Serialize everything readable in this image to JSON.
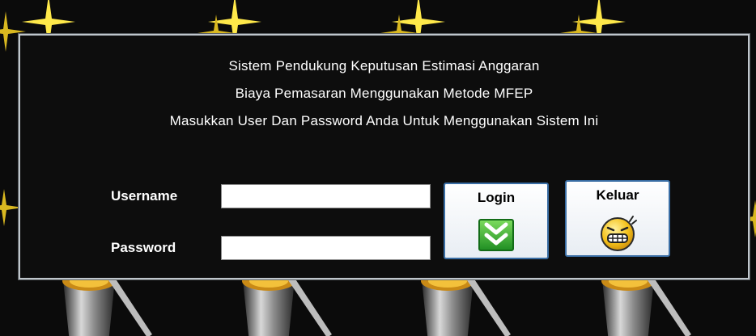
{
  "dialog": {
    "title_line1": "Sistem Pendukung Keputusan Estimasi Anggaran",
    "title_line2": "Biaya Pemasaran Menggunakan Metode MFEP",
    "instruction": "Masukkan User Dan Password Anda Untuk Menggunakan Sistem Ini"
  },
  "form": {
    "username_label": "Username",
    "username_value": "",
    "password_label": "Password",
    "password_value": ""
  },
  "buttons": {
    "login_label": "Login",
    "login_icon": "double-chevron-down-icon",
    "exit_label": "Keluar",
    "exit_icon": "grimace-smiley-icon"
  },
  "colors": {
    "background": "#0b0b0b",
    "panel_border": "#bfc6cc",
    "login_icon_green": "#2fa52f",
    "smiley_yellow": "#f5c21b"
  }
}
